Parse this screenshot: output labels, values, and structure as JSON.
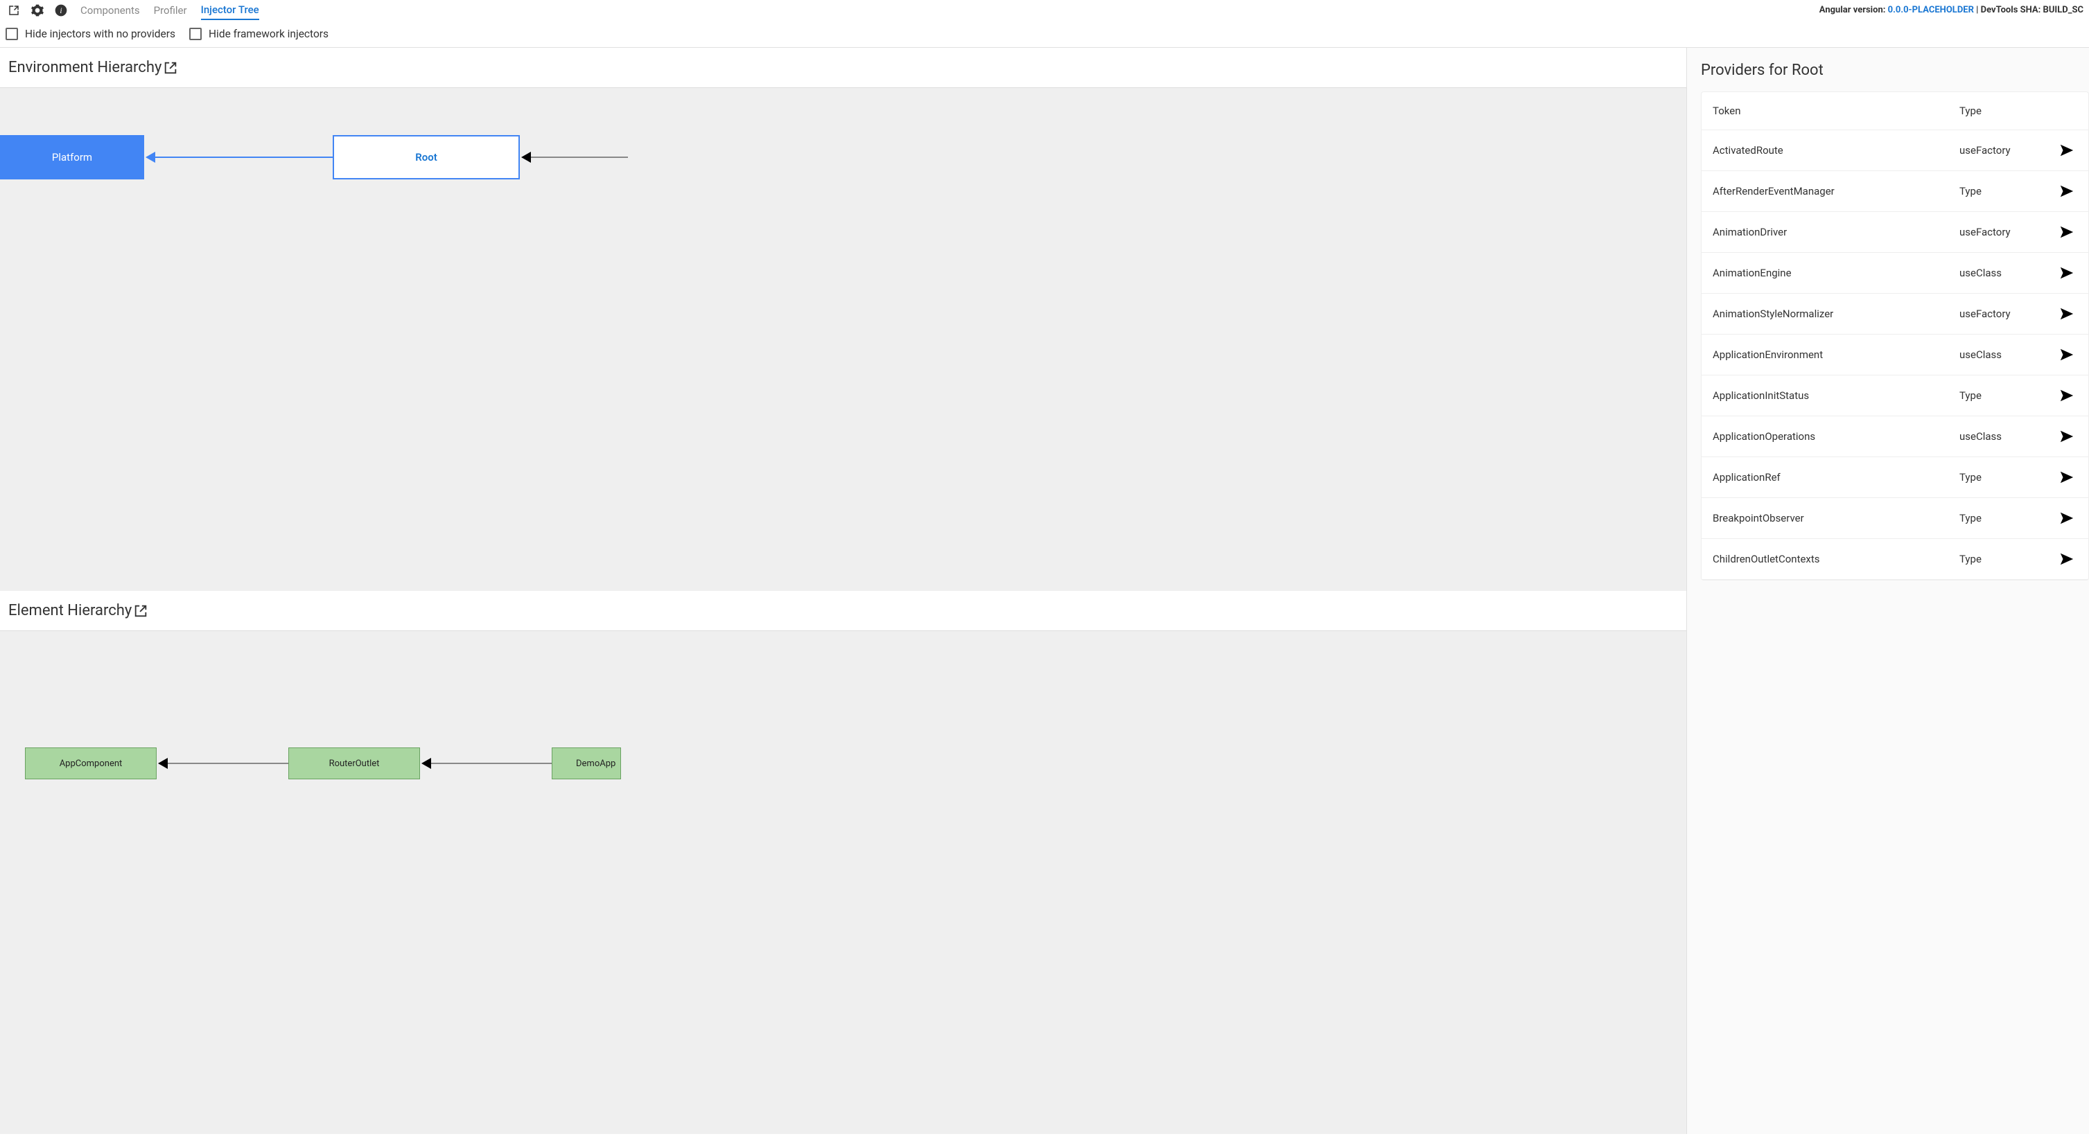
{
  "tabs": {
    "components": "Components",
    "profiler": "Profiler",
    "injector_tree": "Injector Tree"
  },
  "version": {
    "prefix": "Angular version: ",
    "value": "0.0.0-PLACEHOLDER",
    "sha_prefix": " | DevTools SHA: ",
    "sha": "BUILD_SC"
  },
  "filters": {
    "hide_no_providers": "Hide injectors with no providers",
    "hide_framework": "Hide framework injectors"
  },
  "sections": {
    "env": "Environment Hierarchy",
    "elem": "Element Hierarchy"
  },
  "env_nodes": {
    "platform": "Platform",
    "root": "Root"
  },
  "elem_nodes": {
    "app": "AppComponent",
    "router": "RouterOutlet",
    "demo": "DemoApp"
  },
  "providers_title": "Providers for Root",
  "table": {
    "head_token": "Token",
    "head_type": "Type"
  },
  "providers": [
    {
      "token": "ActivatedRoute",
      "type": "useFactory"
    },
    {
      "token": "AfterRenderEventManager",
      "type": "Type"
    },
    {
      "token": "AnimationDriver",
      "type": "useFactory"
    },
    {
      "token": "AnimationEngine",
      "type": "useClass"
    },
    {
      "token": "AnimationStyleNormalizer",
      "type": "useFactory"
    },
    {
      "token": "ApplicationEnvironment",
      "type": "useClass"
    },
    {
      "token": "ApplicationInitStatus",
      "type": "Type"
    },
    {
      "token": "ApplicationOperations",
      "type": "useClass"
    },
    {
      "token": "ApplicationRef",
      "type": "Type"
    },
    {
      "token": "BreakpointObserver",
      "type": "Type"
    },
    {
      "token": "ChildrenOutletContexts",
      "type": "Type"
    }
  ]
}
